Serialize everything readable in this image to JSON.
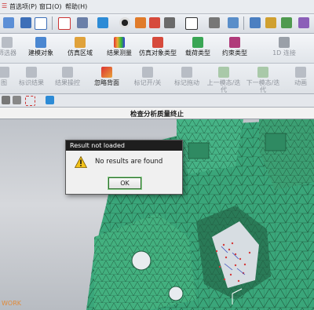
{
  "menubar": {
    "items": [
      {
        "label": "首选项(P)"
      },
      {
        "label": "窗口(O)"
      },
      {
        "label": "帮助(H)"
      }
    ]
  },
  "ribbon_row1": [
    {
      "label": "筛选器",
      "icon": "filter-icon",
      "enabled": false
    },
    {
      "label": "建模对象",
      "icon": "modeling-object-icon",
      "enabled": true
    },
    {
      "label": "仿真区域",
      "icon": "simulation-region-icon",
      "enabled": true
    },
    {
      "label": "结果测量",
      "icon": "result-measure-icon",
      "enabled": true
    },
    {
      "label": "仿真对象类型",
      "icon": "simulation-object-type-icon",
      "enabled": true
    },
    {
      "label": "载荷类型",
      "icon": "load-type-icon",
      "enabled": true
    },
    {
      "label": "约束类型",
      "icon": "constraint-type-icon",
      "enabled": true
    },
    {
      "label": "1D 连接",
      "icon": "1d-connection-icon",
      "enabled": false
    }
  ],
  "ribbon_row2": [
    {
      "label": "图",
      "icon": "graph-icon",
      "enabled": false
    },
    {
      "label": "标识结果",
      "icon": "identify-result-icon",
      "enabled": false
    },
    {
      "label": "结果操控",
      "icon": "result-manipulate-icon",
      "enabled": false
    },
    {
      "label": "忽略背面",
      "icon": "ignore-backface-icon",
      "enabled": true
    },
    {
      "label": "标记开/关",
      "icon": "marker-toggle-icon",
      "enabled": false
    },
    {
      "label": "标记拖动",
      "icon": "marker-drag-icon",
      "enabled": false
    },
    {
      "label": "上一模态/迭代",
      "icon": "previous-mode-icon",
      "enabled": false
    },
    {
      "label": "下一模态/迭代",
      "icon": "next-mode-icon",
      "enabled": false
    },
    {
      "label": "动画",
      "icon": "animation-icon",
      "enabled": false
    }
  ],
  "status": {
    "text": "检查分析质量终止"
  },
  "viewport": {
    "work_label": "WORK"
  },
  "dialog": {
    "title": "Result not loaded",
    "message": "No results are found",
    "icon": "warning-icon",
    "ok_label": "OK"
  },
  "colors": {
    "mesh_fill": "#3aa67a",
    "mesh_edge": "#1f5a3e",
    "dialog_title_bg": "#1e1e1e"
  }
}
